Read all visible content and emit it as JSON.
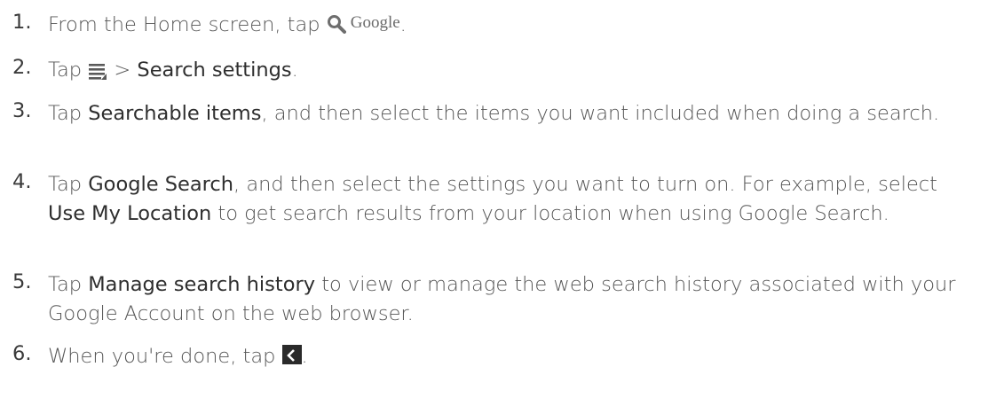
{
  "steps": [
    {
      "number": "1.",
      "text_before": "From the Home screen, tap ",
      "icon_word": "Google",
      "text_after": "."
    },
    {
      "number": "2.",
      "text_before": "Tap ",
      "text_mid": " > ",
      "bold": "Search settings",
      "text_after": "."
    },
    {
      "number": "3.",
      "text_before": "Tap ",
      "bold": "Searchable items",
      "text_after": ", and then select the items you want included when doing a search."
    },
    {
      "number": "4.",
      "text_before": "Tap ",
      "bold": "Google Search",
      "text_mid": ", and then select the settings you want to turn on. For example, select ",
      "bold2": "Use My Location",
      "text_after": " to get search results from your location when using Google Search."
    },
    {
      "number": "5.",
      "text_before": "Tap ",
      "bold": "Manage search history",
      "text_after": " to view or manage the web search history associated with your Google Account on the web browser."
    },
    {
      "number": "6.",
      "text_before": "When you're done, tap ",
      "text_after": "."
    }
  ],
  "icons": {
    "step1": "search-icon",
    "step2": "menu-icon",
    "step6": "back-icon"
  },
  "colors": {
    "text": "#555555",
    "emphasis": "#2e2e2e",
    "icon_dark": "#2a2a2a"
  }
}
